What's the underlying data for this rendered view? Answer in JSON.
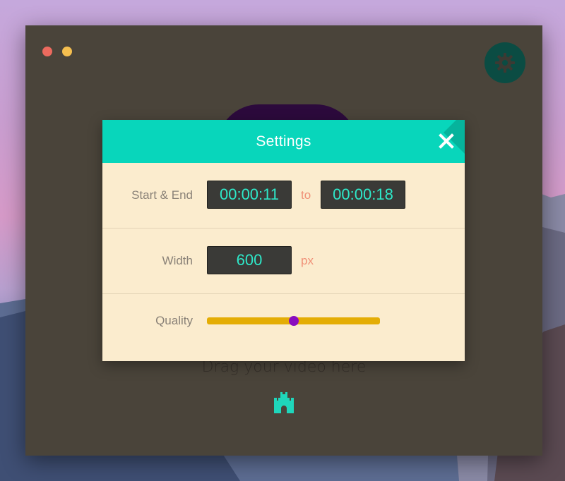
{
  "window": {
    "drop_hint": "Drag your video here"
  },
  "icons": {
    "settings": "gear-icon",
    "close": "close-icon",
    "castle": "castle-icon"
  },
  "settings": {
    "title": "Settings",
    "start_end": {
      "label": "Start & End",
      "start": "00:00:11",
      "separator": "to",
      "end": "00:00:18"
    },
    "width": {
      "label": "Width",
      "value": "600",
      "unit": "px"
    },
    "quality": {
      "label": "Quality",
      "level": 0.5
    }
  },
  "colors": {
    "accent": "#08d6bb",
    "modal_bg": "#fbecce",
    "window_bg": "#4a443a",
    "slider_track": "#e4ad05",
    "slider_thumb": "#8a0dbf",
    "value_text": "#2ee8c9",
    "unit_text": "#f09077"
  }
}
